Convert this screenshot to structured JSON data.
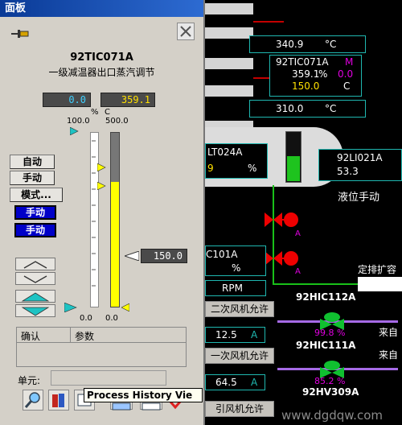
{
  "panel": {
    "title": "面板",
    "tag": "92TIC071A",
    "description": "一级减温器出口蒸汽调节",
    "output_value": "0.0",
    "pv_value": "359.1",
    "unit_percent": "%",
    "unit_c": "C",
    "scale_left_top": "100.0",
    "scale_right_top": "500.0",
    "scale_left_bottom": "0.0",
    "scale_right_bottom": "0.0",
    "sp_value": "150.0",
    "buttons": {
      "auto": "自动",
      "manual": "手动",
      "mode": "模式..."
    },
    "status_manual_1": "手动",
    "status_manual_2": "手动",
    "ack_header": "确认",
    "param_header": "参数",
    "unit_label": "单元:",
    "tooltip": "Process History Vie",
    "output_level": 0.0,
    "pv_level": 0.718
  },
  "bg": {
    "t1_value": "340.9",
    "t1_unit": "°C",
    "tic_tag": "92TIC071A",
    "tic_m": "M",
    "tic_pv": "359.1",
    "tic_out": "0.0",
    "tic_sp": "150.0",
    "tic_unit1": "%",
    "tic_unit2": "C",
    "t2_value": "310.0",
    "t2_unit": "°C",
    "lt_tag": "LT024A",
    "lt_val": "9",
    "lt_unit": "%",
    "li_tag": "92LI021A",
    "li_val": "53.3",
    "level_manual": "液位手动",
    "a1": "A",
    "a2": "A",
    "c101_tag": "C101A",
    "c101_unit": "%",
    "rpm": "RPM",
    "fixed_drain": "定排扩容",
    "hic112_tag": "92HIC112A",
    "fan_permit_2": "二次风机允许",
    "hic112_val": "99.8 %",
    "flow_val": "12.5",
    "flow_unit": "A",
    "come_from_1": "来自",
    "fan_permit_1": "一次风机允许",
    "hic111_tag": "92HIC111A",
    "come_from_2": "来自",
    "hic111_val": "85.2 %",
    "val_64": "64.5",
    "val_64_unit": "A",
    "hv_tag": "92HV309A",
    "induced_fan": "引风机允许",
    "watermark": "www.dgdqw.com"
  }
}
